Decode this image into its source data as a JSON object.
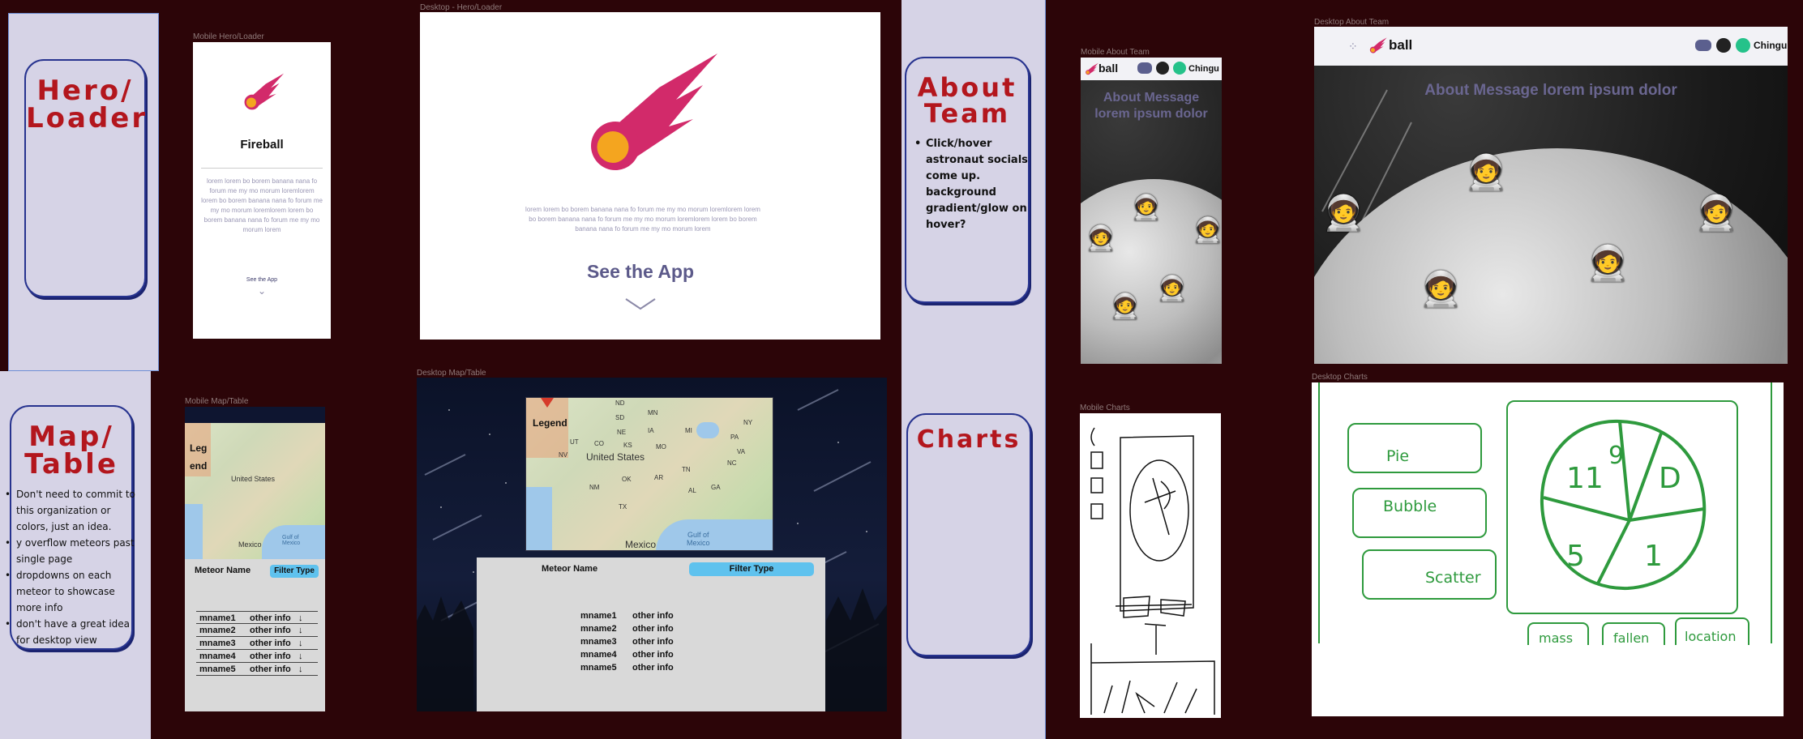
{
  "sections": {
    "hero": {
      "title": "Hero/\nLoader"
    },
    "map": {
      "title": "Map/\nTable",
      "notes": [
        "Don't need to commit to this organization or colors, just an idea.",
        "y overflow meteors past single page",
        "dropdowns on each meteor to showcase more info",
        "don't have a great idea for desktop view"
      ]
    },
    "about": {
      "title": "About\nTeam",
      "notes": [
        "Click/hover astronaut socials come up. background gradient/glow on hover?"
      ]
    },
    "charts": {
      "title": "Charts"
    }
  },
  "frames": {
    "mobile_hero": {
      "label": "Mobile Hero/Loader",
      "app_name": "Fireball",
      "lorem": "lorem lorem bo borem banana nana fo forum me my mo morum loremlorem lorem bo borem banana nana fo forum me my mo morum loremlorem lorem bo borem banana nana fo forum me my mo morum lorem",
      "cta": "See the App"
    },
    "desktop_hero": {
      "label": "Desktop - Hero/Loader",
      "lorem": "lorem lorem bo borem banana nana fo forum me my mo morum loremlorem lorem bo borem banana nana fo forum me my mo morum loremlorem lorem bo borem banana nana fo forum me my mo morum lorem",
      "cta": "See the App"
    },
    "mobile_map": {
      "label": "Mobile Map/Table",
      "legend_1": "Leg",
      "legend_2": "end",
      "country_1": "United States",
      "country_2": "Mexico",
      "gulf": "Gulf of\nMexico",
      "col_name": "Meteor Name",
      "filter": "Filter Type",
      "rows": [
        {
          "name": "mname1",
          "info": "other info"
        },
        {
          "name": "mname2",
          "info": "other info"
        },
        {
          "name": "mname3",
          "info": "other info"
        },
        {
          "name": "mname4",
          "info": "other info"
        },
        {
          "name": "mname5",
          "info": "other info"
        }
      ],
      "row_icon": "↓"
    },
    "desktop_map": {
      "label": "Desktop Map/Table",
      "legend": "Legend",
      "country_1": "United States",
      "country_2": "Mexico",
      "gulf": "Gulf of\nMexico",
      "states": [
        "ND",
        "SD",
        "MN",
        "NE",
        "IA",
        "NV",
        "UT",
        "CO",
        "KS",
        "MO",
        "NM",
        "OK",
        "AR",
        "TN",
        "NC",
        "TX",
        "AL",
        "GA",
        "MI",
        "PA",
        "NY",
        "VA"
      ],
      "col_name": "Meteor Name",
      "filter": "Filter Type",
      "rows": [
        {
          "name": "mname1",
          "info": "other info"
        },
        {
          "name": "mname2",
          "info": "other info"
        },
        {
          "name": "mname3",
          "info": "other info"
        },
        {
          "name": "mname4",
          "info": "other info"
        },
        {
          "name": "mname5",
          "info": "other info"
        }
      ]
    },
    "mobile_about": {
      "label": "Mobile About Team",
      "brand": "ball",
      "chingu": "Chingu",
      "message": "About Message lorem ipsum dolor"
    },
    "desktop_about": {
      "label": "Desktop About Team",
      "brand": "ball",
      "chingu": "Chingu",
      "message": "About Message lorem ipsum dolor"
    },
    "mobile_charts": {
      "label": "Mobile Charts"
    },
    "desktop_charts": {
      "label": "Desktop Charts",
      "buttons": [
        "Pie",
        "Bubble",
        "Scatter"
      ],
      "tabs": [
        "mass",
        "fallen",
        "location"
      ],
      "pie_digits": [
        "11",
        "9",
        "D",
        "5",
        "1"
      ]
    }
  },
  "colors": {
    "background": "#2c0508",
    "panel": "#d6d3e6",
    "card_border": "#27338f",
    "title_red": "#b3161d",
    "fireball_pink": "#d22a6a",
    "fireball_orange": "#f4a51f",
    "cta_purple": "#5c5a8a",
    "filter_blue": "#5fc2ee",
    "sketch_green": "#2e9a3d"
  },
  "icons": [
    "fireball-icon",
    "discord-icon",
    "github-icon",
    "chingu-icon",
    "chevron-down-icon",
    "arrow-down-icon",
    "dots-icon"
  ]
}
